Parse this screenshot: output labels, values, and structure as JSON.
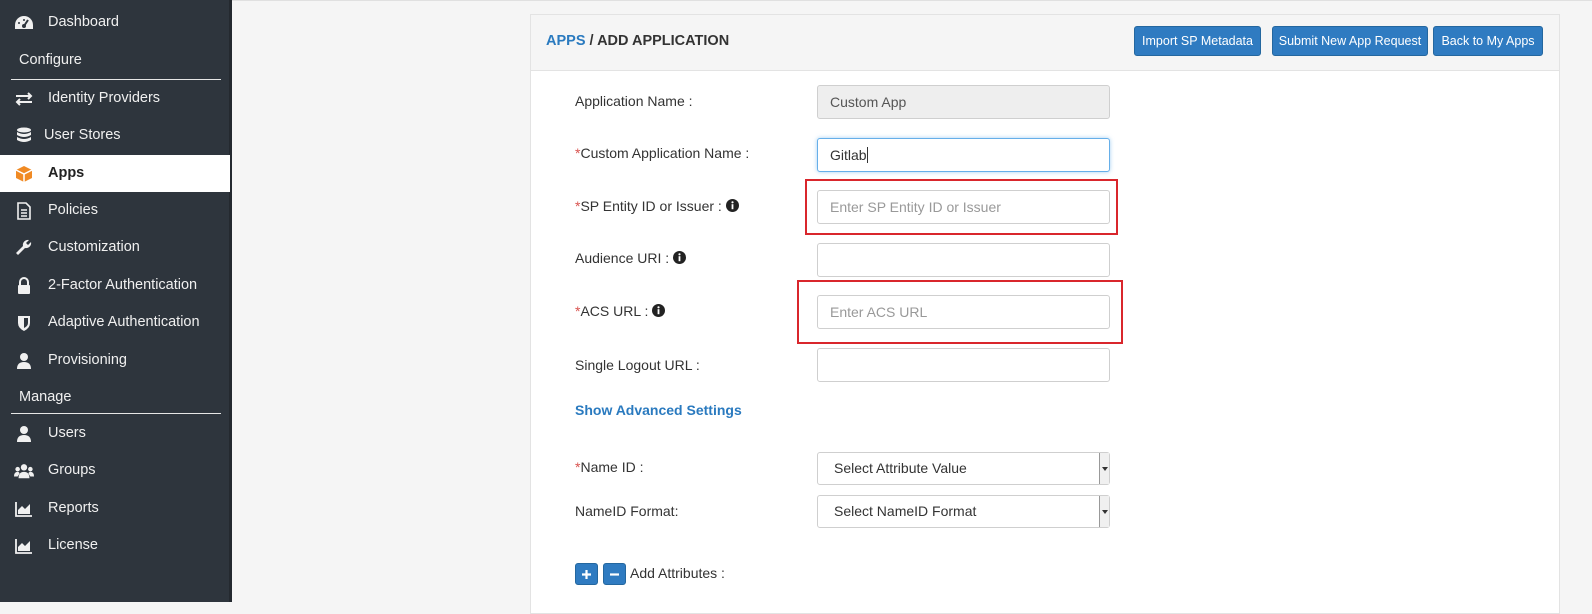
{
  "sidebar": {
    "items": [
      {
        "label": "Dashboard",
        "icon": "dashboard-icon"
      },
      {
        "label": "Identity Providers",
        "icon": "exchange-icon"
      },
      {
        "label": "User Stores",
        "icon": "database-icon"
      },
      {
        "label": "Apps",
        "icon": "cube-icon",
        "active": true
      },
      {
        "label": "Policies",
        "icon": "document-icon"
      },
      {
        "label": "Customization",
        "icon": "wrench-icon"
      },
      {
        "label": "2-Factor Authentication",
        "icon": "lock-icon"
      },
      {
        "label": "Adaptive Authentication",
        "icon": "shield-icon"
      },
      {
        "label": "Provisioning",
        "icon": "user-icon"
      },
      {
        "label": "Users",
        "icon": "user-icon"
      },
      {
        "label": "Groups",
        "icon": "users-icon"
      },
      {
        "label": "Reports",
        "icon": "area-chart-icon"
      },
      {
        "label": "License",
        "icon": "area-chart-icon"
      }
    ],
    "sections": {
      "configure": "Configure",
      "manage": "Manage"
    }
  },
  "header": {
    "crumb_link": "APPS",
    "crumb_sep": " / ",
    "crumb_current": "ADD APPLICATION",
    "buttons": {
      "import": "Import SP Metadata",
      "submit": "Submit New App Request",
      "back": "Back to My Apps"
    }
  },
  "form": {
    "app_name_label": "Application Name :",
    "app_name_value": "Custom App",
    "custom_name_label": "Custom Application Name :",
    "custom_name_value": "Gitlab",
    "sp_entity_label": "SP Entity ID or Issuer :",
    "sp_entity_placeholder": "Enter SP Entity ID or Issuer",
    "audience_label": "Audience URI :",
    "acs_label": "ACS URL :",
    "acs_placeholder": "Enter ACS URL",
    "slo_label": "Single Logout URL :",
    "advanced_link": "Show Advanced Settings",
    "nameid_label": "Name ID :",
    "nameid_value": "Select Attribute Value",
    "nameid_format_label": "NameID Format:",
    "nameid_format_value": "Select NameID Format",
    "add_attributes_label": "Add Attributes :",
    "required_mark": "*"
  },
  "colors": {
    "sidebar_bg": "#2e353d",
    "accent": "#2f7bc1",
    "link": "#2a7abf",
    "highlight": "#d9262c",
    "required": "#d9534f"
  }
}
